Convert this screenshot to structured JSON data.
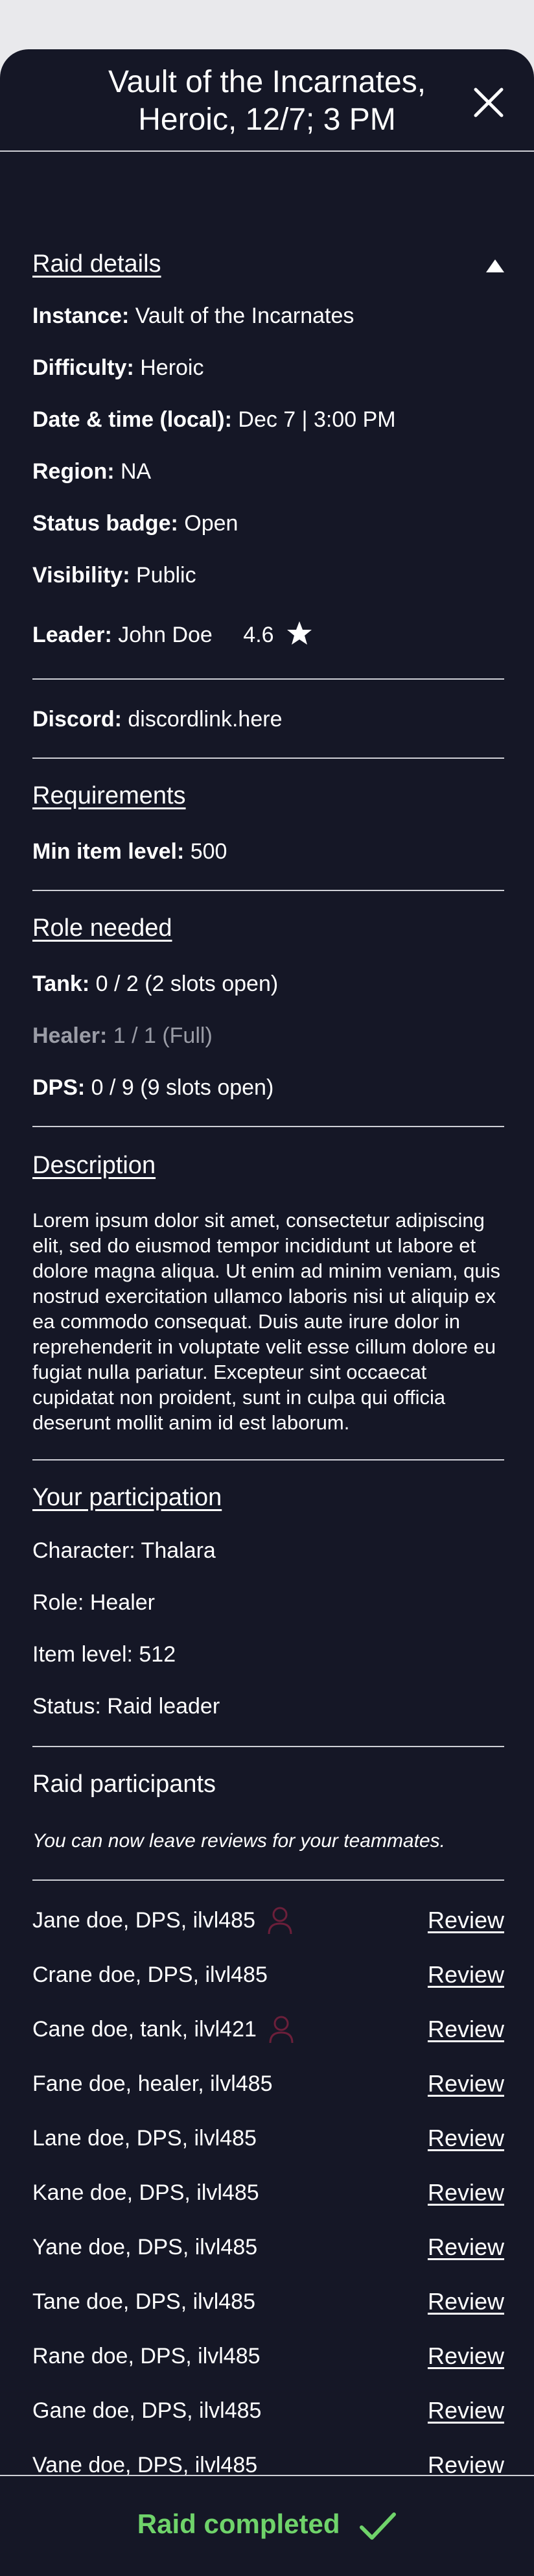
{
  "header": {
    "title": "Vault of the Incarnates, Heroic, 12/7; 3 PM"
  },
  "raid_details": {
    "section_title": "Raid details",
    "instance_label": "Instance:",
    "instance_value": " Vault of the Incarnates",
    "difficulty_label": "Difficulty:",
    "difficulty_value": " Heroic",
    "datetime_label": "Date & time (local):",
    "datetime_value": " Dec 7 | 3:00 PM",
    "region_label": "Region:",
    "region_value": " NA",
    "status_label": "Status badge:",
    "status_value": " Open",
    "visibility_label": "Visibility:",
    "visibility_value": " Public",
    "leader_label": "Leader:",
    "leader_value": " John Doe",
    "leader_rating": "4.6",
    "discord_label": "Discord:",
    "discord_value": " discordlink.here"
  },
  "requirements": {
    "section_title": "Requirements",
    "min_ilvl_label": "Min item level:",
    "min_ilvl_value": " 500"
  },
  "roles": {
    "section_title": "Role needed",
    "tank_label": "Tank:",
    "tank_value": " 0 / 2 (2 slots open)",
    "healer_label": "Healer:",
    "healer_value": " 1 / 1 (Full)",
    "dps_label": "DPS:",
    "dps_value": " 0 / 9 (9 slots open)"
  },
  "description": {
    "section_title": "Description",
    "text": "Lorem ipsum dolor sit amet, consectetur adipiscing elit, sed do eiusmod tempor incididunt ut labore et dolore magna aliqua. Ut enim ad minim veniam, quis nostrud exercitation ullamco laboris nisi ut aliquip ex ea commodo consequat. Duis aute irure dolor in reprehenderit in voluptate velit esse cillum dolore eu fugiat nulla pariatur. Excepteur sint occaecat cupidatat non proident, sunt in culpa qui officia deserunt mollit anim id est laborum."
  },
  "participation": {
    "section_title": "Your participation",
    "character": "Character: Thalara",
    "role": "Role: Healer",
    "item_level": "Item level: 512",
    "status": "Status: Raid leader"
  },
  "participants": {
    "section_title": "Raid participants",
    "note": "You can now leave reviews for your teammates.",
    "review_label": "Review",
    "list": [
      {
        "name": "Jane doe, DPS, ilvl485",
        "flag": true
      },
      {
        "name": "Crane doe, DPS, ilvl485",
        "flag": false
      },
      {
        "name": "Cane doe, tank, ilvl421",
        "flag": true
      },
      {
        "name": "Fane doe, healer, ilvl485",
        "flag": false
      },
      {
        "name": "Lane doe, DPS, ilvl485",
        "flag": false
      },
      {
        "name": "Kane doe, DPS, ilvl485",
        "flag": false
      },
      {
        "name": "Yane doe, DPS, ilvl485",
        "flag": false
      },
      {
        "name": "Tane doe, DPS, ilvl485",
        "flag": false
      },
      {
        "name": "Rane doe, DPS, ilvl485",
        "flag": false
      },
      {
        "name": "Gane doe, DPS, ilvl485",
        "flag": false
      },
      {
        "name": "Vane doe, DPS, ilvl485",
        "flag": false
      }
    ]
  },
  "footer": {
    "status_text": "Raid completed"
  },
  "colors": {
    "background": "#151726",
    "success": "#6fd36a",
    "flag_icon": "#6b1f3a",
    "muted_text": "#9a9ca6"
  },
  "icons": {
    "close": "close-icon",
    "collapse": "chevron-up-icon",
    "rating": "star-icon",
    "flag": "person-outline-icon",
    "complete": "check-icon"
  }
}
